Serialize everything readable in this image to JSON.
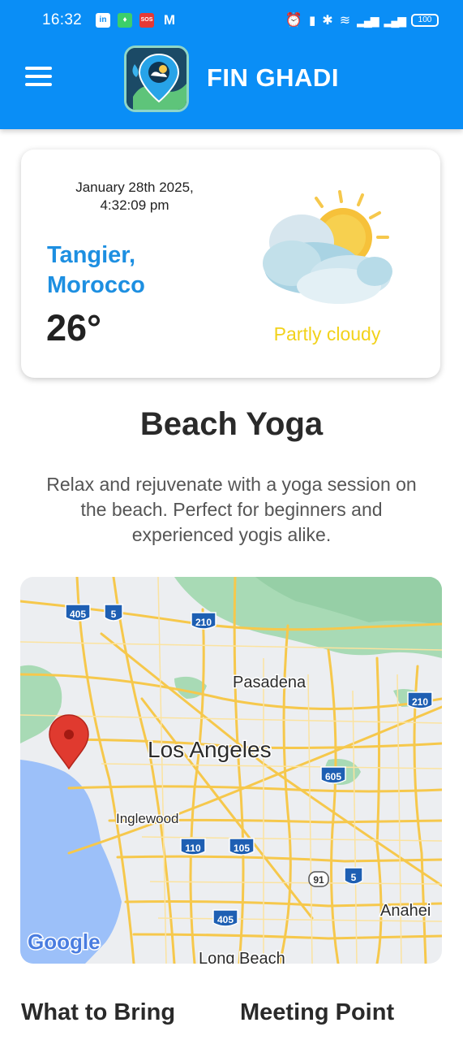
{
  "status_bar": {
    "time": "16:32",
    "battery": "100"
  },
  "app": {
    "title": "FIN GHADI"
  },
  "weather": {
    "date_line1": "January 28th 2025,",
    "date_line2": "4:32:09 pm",
    "city_line1": "Tangier,",
    "city_line2": "Morocco",
    "temperature": "26°",
    "condition": "Partly cloudy",
    "condition_color": "#f2d21b",
    "city_color": "#1d8fe1"
  },
  "activity": {
    "title": "Beach Yoga",
    "description": "Relax and rejuvenate with a yoga session on the beach. Perfect for beginners and experienced yogis alike."
  },
  "map": {
    "labels": {
      "pasadena": "Pasadena",
      "los_angeles": "Los Angeles",
      "inglewood": "Inglewood",
      "anaheim": "Anahei",
      "long_beach": "Long Beach",
      "google": "Google"
    },
    "shields": {
      "i405_top": "405",
      "us5_top": "5",
      "i210_top": "210",
      "i210_right": "210",
      "i605": "605",
      "i110": "110",
      "i105": "105",
      "sr91": "91",
      "i5_bottom": "5",
      "i405_bottom": "405"
    }
  },
  "sections": {
    "what_to_bring": "What to Bring",
    "meeting_point": "Meeting Point"
  },
  "colors": {
    "app_bar": "#0a8ef6",
    "map_water": "#9cc0f9",
    "map_park": "#a8dab5",
    "map_road": "#f6c84c"
  }
}
